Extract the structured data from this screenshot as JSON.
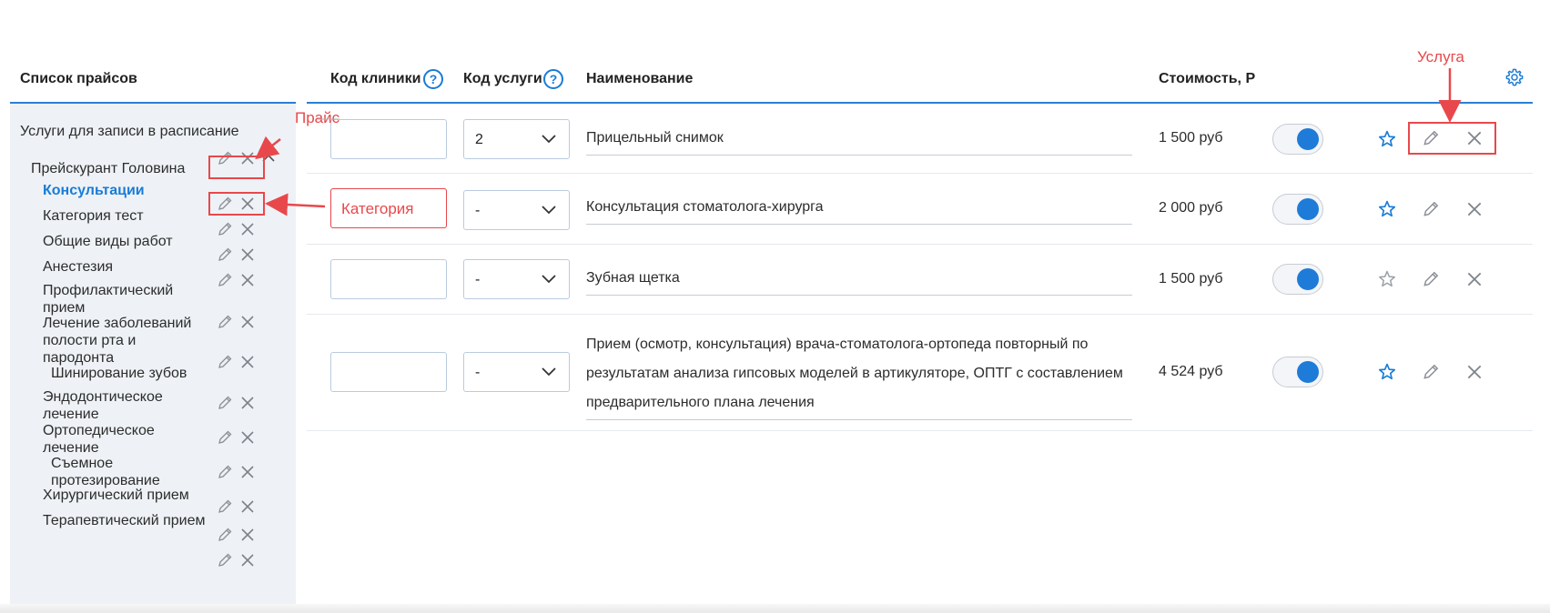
{
  "sidebar": {
    "title": "Список прайсов",
    "group_title": "Услуги для записи в расписание",
    "pricelist_name": "Прейскурант Головина",
    "categories": [
      {
        "label": "Консультации",
        "active": true
      },
      {
        "label": "Категория тест"
      },
      {
        "label": "Общие виды работ"
      },
      {
        "label": "Анестезия"
      },
      {
        "label": "Профилактический прием"
      },
      {
        "label": "Лечение заболеваний полости рта и пародонта"
      },
      {
        "label": "Шинирование зубов"
      },
      {
        "label": "Эндодонтическое лечение"
      },
      {
        "label": "Ортопедическое лечение"
      },
      {
        "label": "Съемное протезирование"
      },
      {
        "label": "Хирургический прием"
      },
      {
        "label": "Терапевтический прием"
      }
    ]
  },
  "table": {
    "headers": {
      "clinic_code": "Код клиники",
      "service_code": "Код услуги",
      "name": "Наименование",
      "price": "Стоимость, Р"
    },
    "rows": [
      {
        "clinic_code": "",
        "service_code": "2",
        "name": "Прицельный снимок",
        "price": "1 500 руб",
        "enabled": true,
        "favorite": true
      },
      {
        "clinic_code": "",
        "service_code": "-",
        "name": "Консультация стоматолога-хирурга",
        "price": "2 000 руб",
        "enabled": true,
        "favorite": true
      },
      {
        "clinic_code": "",
        "service_code": "-",
        "name": "Зубная щетка",
        "price": "1 500 руб",
        "enabled": true,
        "favorite": false
      },
      {
        "clinic_code": "",
        "service_code": "-",
        "name": "Прием (осмотр, консультация) врача-стоматолога-ортопеда повторный по результатам анализа гипсовых моделей в артикуляторе, ОПТГ с составлением предварительного плана лечения",
        "price": "4 524 руб",
        "enabled": true,
        "favorite": true
      }
    ]
  },
  "annotations": {
    "price_label": "Прайс",
    "category_label": "Категория",
    "service_label": "Услуга"
  },
  "icons": {
    "help": "help-circle-icon",
    "settings": "gear-icon",
    "edit": "pencil-icon",
    "delete": "close-icon",
    "favorite": "star-icon",
    "collapse": "chevron-up-icon",
    "dropdown": "chevron-down-icon"
  },
  "colors": {
    "accent": "#1a7bd6",
    "annotation": "#e8484b",
    "sidebar_bg": "#eef2f6"
  }
}
